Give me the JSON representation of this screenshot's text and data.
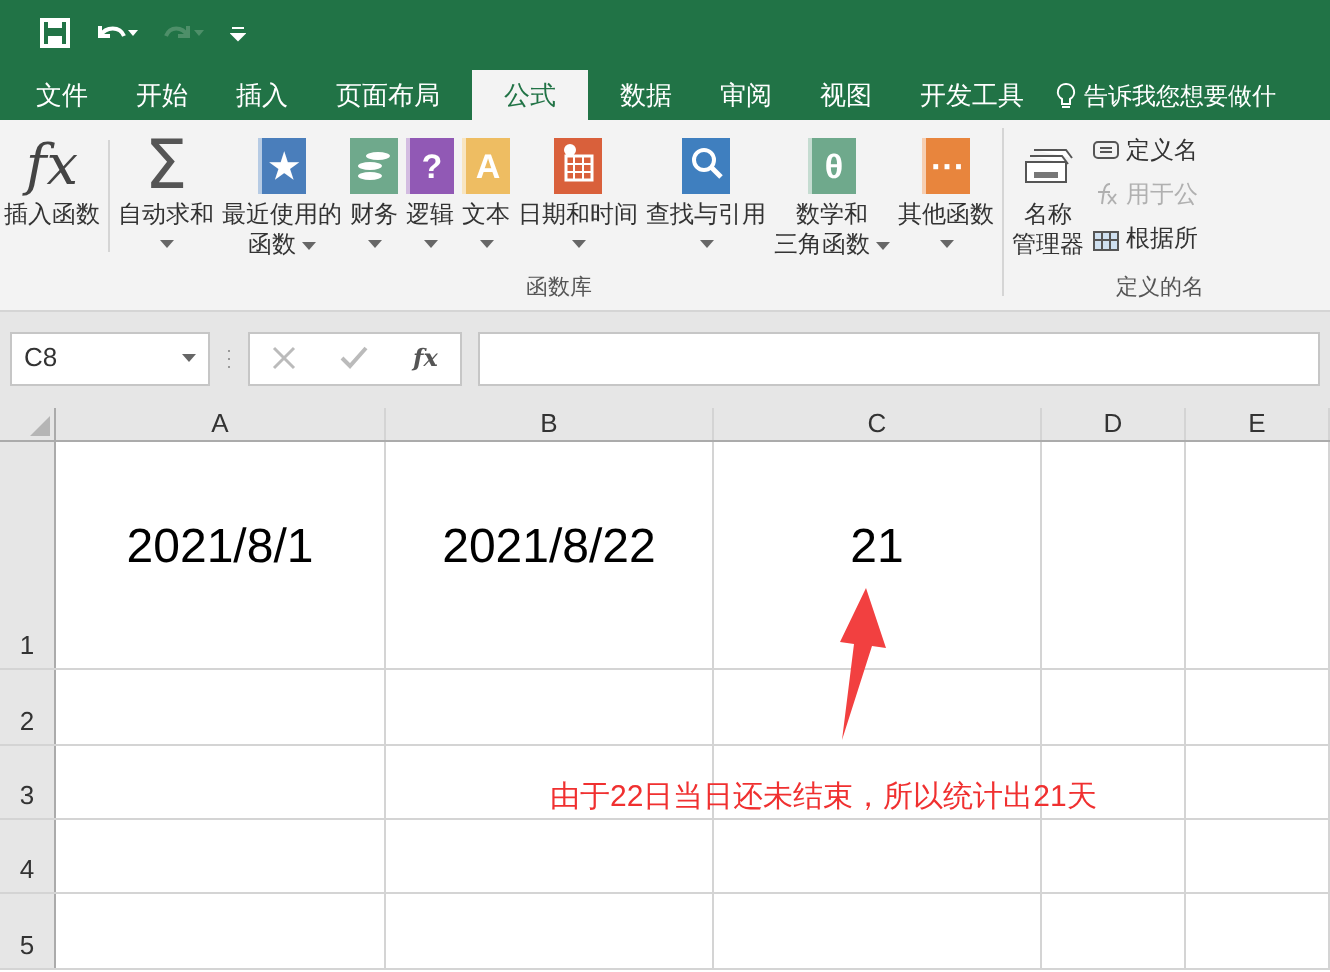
{
  "quick_access": {
    "undo_enabled": true,
    "redo_enabled": false
  },
  "tabs": [
    {
      "label": "文件",
      "selected": false
    },
    {
      "label": "开始",
      "selected": false
    },
    {
      "label": "插入",
      "selected": false
    },
    {
      "label": "页面布局",
      "selected": false
    },
    {
      "label": "公式",
      "selected": true
    },
    {
      "label": "数据",
      "selected": false
    },
    {
      "label": "审阅",
      "selected": false
    },
    {
      "label": "视图",
      "selected": false
    },
    {
      "label": "开发工具",
      "selected": false
    }
  ],
  "tell_me": "告诉我您想要做什",
  "ribbon": {
    "function_library": {
      "label": "函数库",
      "buttons": [
        {
          "kind": "glyph",
          "glyph": "fx",
          "lines": [
            "插入函数"
          ],
          "caret": false
        },
        {
          "kind": "sigma",
          "glyph": "Σ",
          "lines": [
            "自动求和"
          ],
          "caret": true
        },
        {
          "kind": "book",
          "glyph": "★",
          "color": "#4a7ebb",
          "lines": [
            "最近使用的",
            "函数"
          ],
          "caret": true
        },
        {
          "kind": "coins",
          "color": "#6fa98c",
          "lines": [
            "财务"
          ],
          "caret": true
        },
        {
          "kind": "book",
          "glyph": "?",
          "color": "#9159b5",
          "lines": [
            "逻辑"
          ],
          "caret": true
        },
        {
          "kind": "book",
          "glyph": "A",
          "color": "#eebd62",
          "lines": [
            "文本"
          ],
          "caret": true
        },
        {
          "kind": "calendar",
          "color": "#d9603b",
          "lines": [
            "日期和时间"
          ],
          "caret": true
        },
        {
          "kind": "magnifier",
          "color": "#3f7fbf",
          "lines": [
            "查找与引用"
          ],
          "caret": true
        },
        {
          "kind": "book",
          "glyph": "θ",
          "color": "#6fa98c",
          "lines": [
            "数学和",
            "三角函数"
          ],
          "caret": true
        },
        {
          "kind": "book",
          "glyph": "···",
          "color": "#e8853d",
          "lines": [
            "其他函数"
          ],
          "caret": true
        }
      ]
    },
    "defined_names": {
      "label": "定义的名",
      "manager": [
        "名称",
        "管理器"
      ],
      "items": [
        {
          "kind": "tag",
          "label": "定义名",
          "disabled": false
        },
        {
          "kind": "fx",
          "label": "用于公",
          "disabled": true
        },
        {
          "kind": "grid",
          "label": "根据所",
          "disabled": false
        }
      ]
    }
  },
  "formula_bar": {
    "name_box": "C8",
    "fx": "fx"
  },
  "columns": [
    "A",
    "B",
    "C",
    "D",
    "E"
  ],
  "rows": [
    {
      "header": "1",
      "cells": [
        "2021/8/1",
        "2021/8/22",
        "21",
        "",
        ""
      ]
    },
    {
      "header": "2",
      "cells": [
        "",
        "",
        "",
        "",
        ""
      ]
    },
    {
      "header": "3",
      "cells": [
        "",
        "",
        "",
        "",
        ""
      ]
    },
    {
      "header": "4",
      "cells": [
        "",
        "",
        "",
        "",
        ""
      ]
    },
    {
      "header": "5",
      "cells": [
        "",
        "",
        "",
        "",
        ""
      ]
    }
  ],
  "annotation": "由于22日当日还未结束，所以统计出21天"
}
